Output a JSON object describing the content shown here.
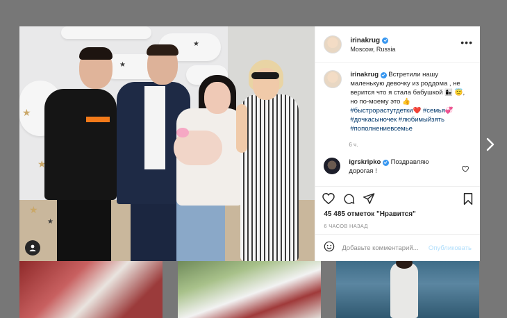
{
  "post": {
    "username": "irinakrug",
    "location": "Moscow, Russia",
    "caption": {
      "username": "irinakrug",
      "text": "Встретили нашу маленькую девочку из роддома , не верится что я стала бабушкой 👩‍👧 😇, но по-моему это 👍",
      "hashtags": "#быстрорастутдетки❤️ #семья💞 #дочкасыночек #любимыйзять #пополнениевсемье"
    },
    "caption_time": "6 ч.",
    "comment": {
      "username": "igrskripko",
      "text": "Поздравляю дорогая !"
    },
    "likes_text": "45 485 отметок \"Нравится\"",
    "posted_ago": "6 ЧАСОВ НАЗАД",
    "add_comment_placeholder": "Добавьте комментарий...",
    "publish_label": "Опубликовать"
  },
  "icons": {
    "more": "more-options-icon",
    "like": "heart-icon",
    "comment": "comment-icon",
    "share": "share-icon",
    "save": "bookmark-icon",
    "emoji": "emoji-icon",
    "user_tags": "user-tag-icon",
    "next": "chevron-right-icon"
  },
  "colors": {
    "verified": "#3897f0",
    "hashtag": "#00376b",
    "publish_disabled": "#b2dffc"
  }
}
